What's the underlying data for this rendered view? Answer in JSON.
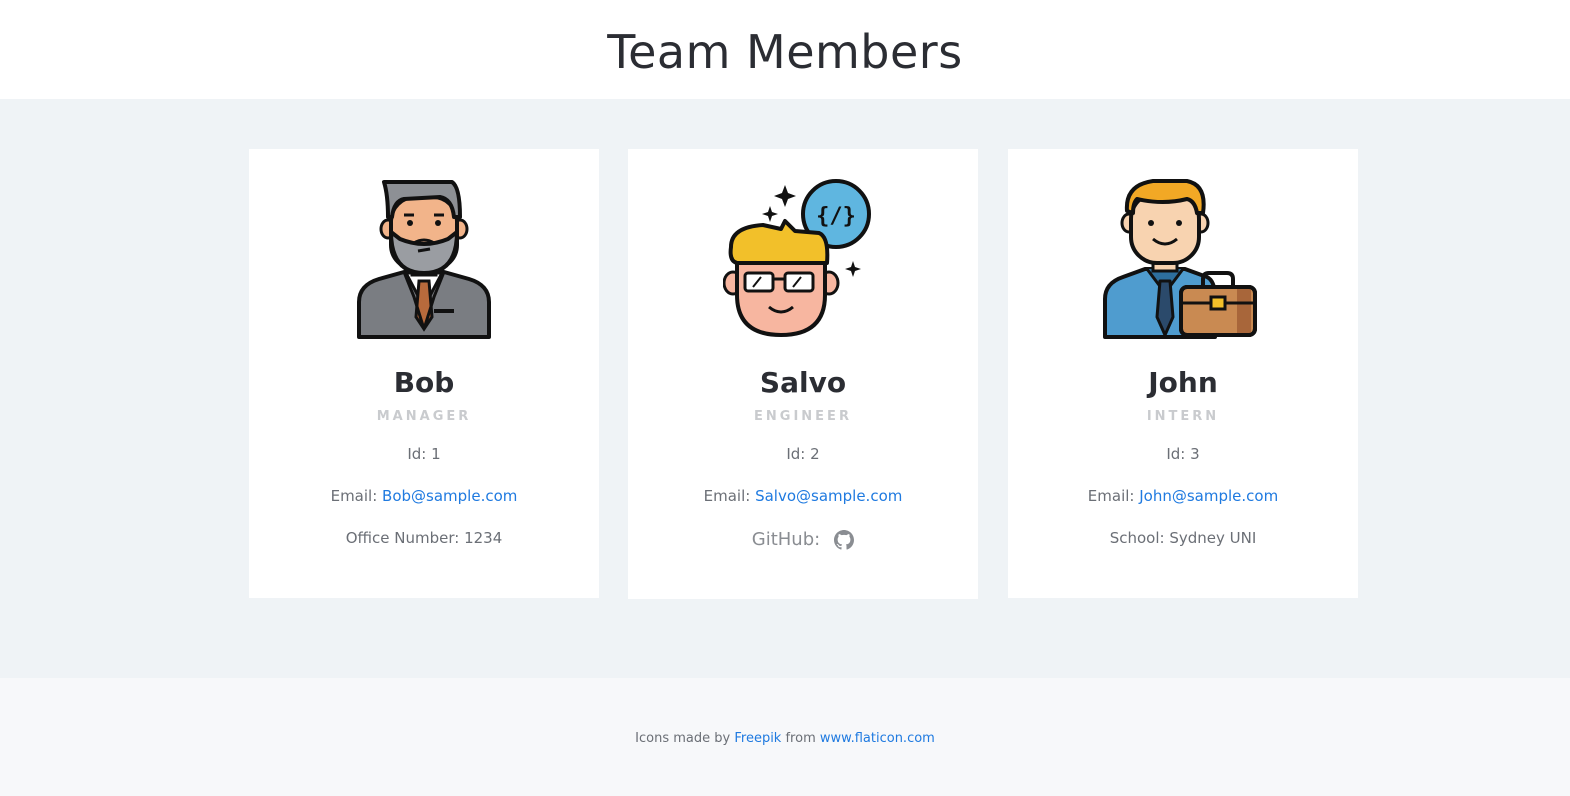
{
  "page": {
    "title": "Team Members"
  },
  "members": [
    {
      "name": "Bob",
      "role": "MANAGER",
      "id_label": "Id:",
      "id": "1",
      "email_label": "Email:",
      "email": "Bob@sample.com",
      "extra_label": "Office Number:",
      "extra_value": "1234",
      "avatar_icon": "manager-avatar-icon"
    },
    {
      "name": "Salvo",
      "role": "ENGINEER",
      "id_label": "Id:",
      "id": "2",
      "email_label": "Email:",
      "email": "Salvo@sample.com",
      "extra_label": "GitHub:",
      "extra_icon": "github-icon",
      "avatar_icon": "engineer-avatar-icon"
    },
    {
      "name": "John",
      "role": "INTERN",
      "id_label": "Id:",
      "id": "3",
      "email_label": "Email:",
      "email": "John@sample.com",
      "extra_label": "School:",
      "extra_value": "Sydney UNI",
      "avatar_icon": "intern-avatar-icon"
    }
  ],
  "footer": {
    "prefix": "Icons made by",
    "author_link": "Freepik",
    "middle": "from",
    "site_link": "www.flaticon.com"
  },
  "colors": {
    "link": "#1f7ae0",
    "section_bg": "#eff3f6",
    "footer_bg": "#f7f8fa",
    "role_text": "#c9cbce"
  }
}
